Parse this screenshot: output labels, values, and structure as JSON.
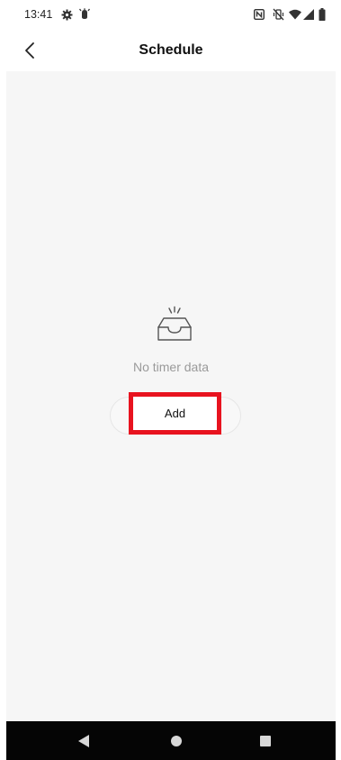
{
  "status_bar": {
    "time": "13:41",
    "icons": [
      "gear-icon",
      "notification-icon",
      "nfc-icon",
      "vibrate-off-icon",
      "wifi-icon",
      "signal-icon",
      "battery-icon"
    ]
  },
  "header": {
    "title": "Schedule",
    "back_icon": "chevron-left-icon"
  },
  "empty_state": {
    "icon": "empty-inbox-icon",
    "message": "No timer data",
    "add_label": "Add"
  },
  "nav_bar": {
    "buttons": [
      "back-triangle-icon",
      "home-circle-icon",
      "recents-square-icon"
    ]
  },
  "colors": {
    "content_background": "#f6f6f6",
    "highlight": "#e8131f",
    "nav_background": "#050505",
    "muted_text": "#9a9a9a"
  }
}
